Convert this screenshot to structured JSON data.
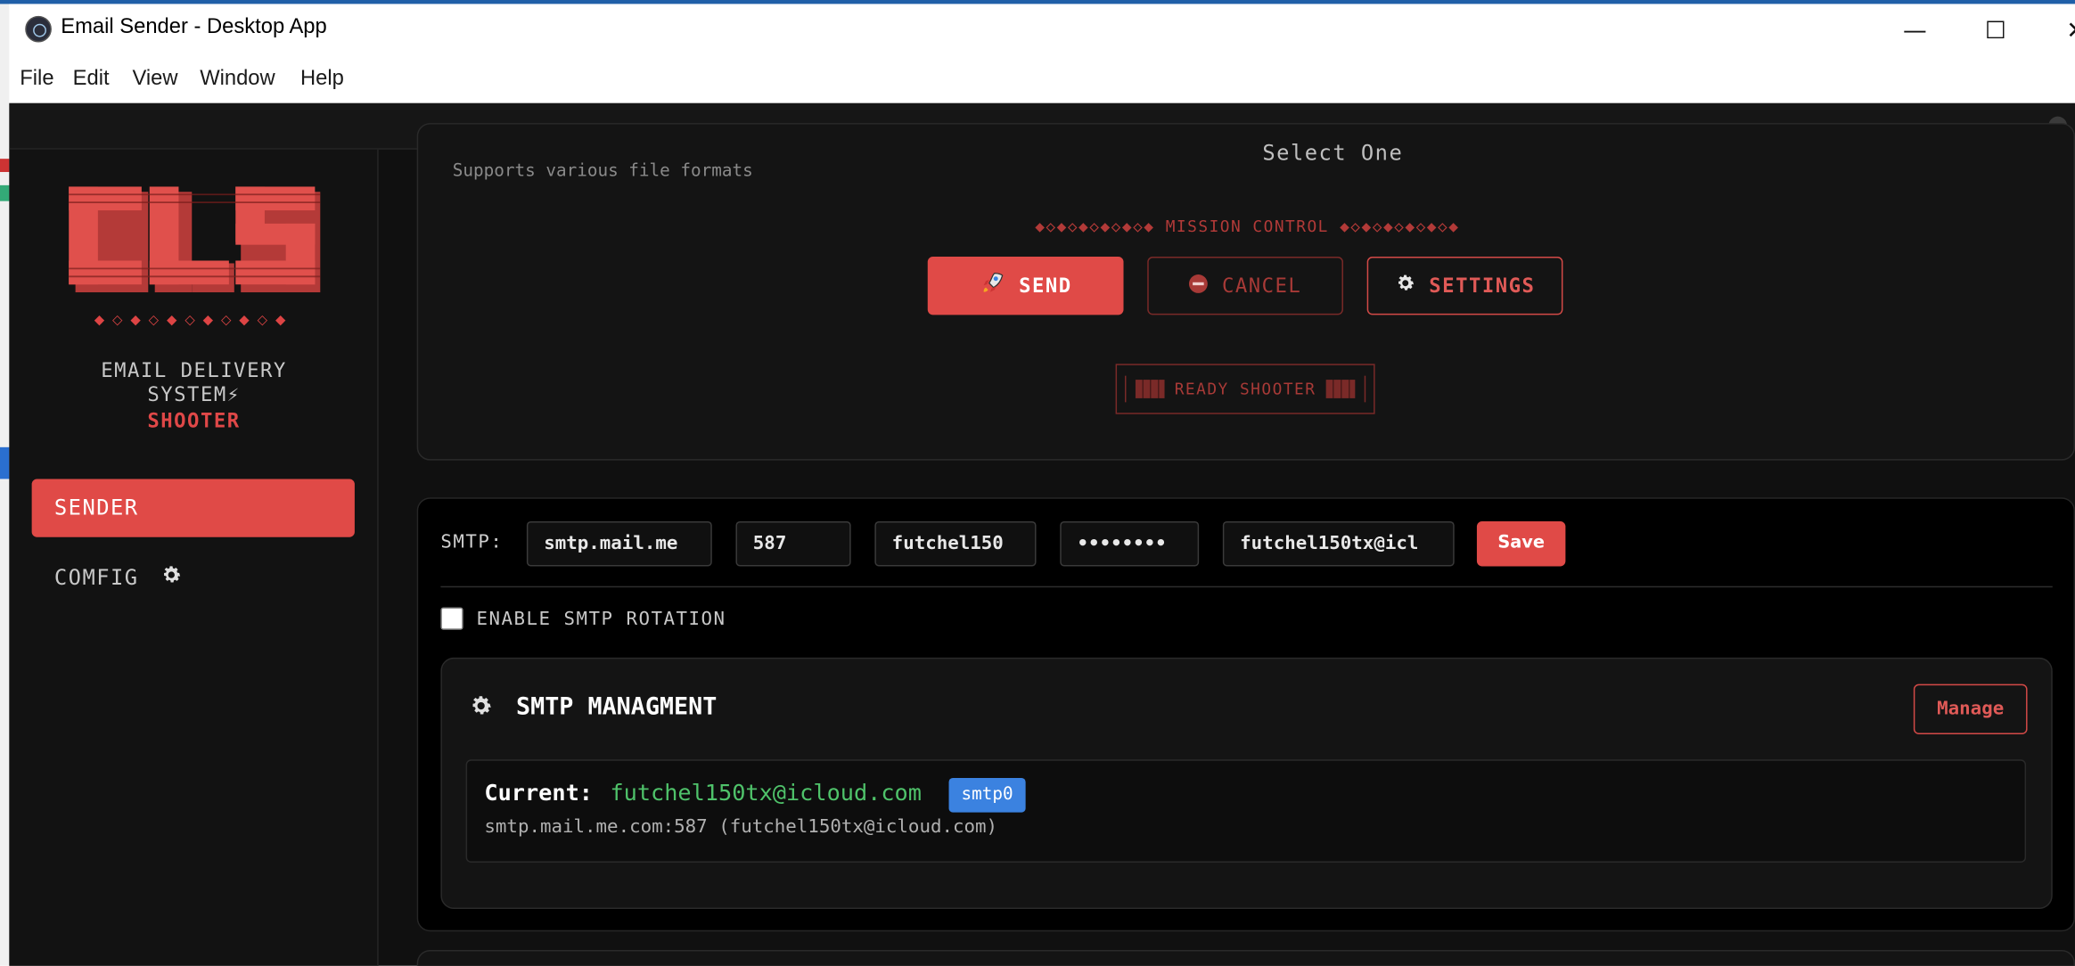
{
  "window": {
    "title": "Email Sender - Desktop App",
    "controls": {
      "minimize": "—",
      "maximize": "☐",
      "close": "✕"
    }
  },
  "menu": [
    "File",
    "Edit",
    "View",
    "Window",
    "Help"
  ],
  "sidebar": {
    "logo_text": "CLS",
    "diamonds": "◆◇◆◇◆◇◆◇◆◇◆",
    "brand_line1": "EMAIL DELIVERY",
    "brand_line2": "SYSTEM⚡",
    "brand_line3": "SHOOTER",
    "items": [
      {
        "label": "SENDER",
        "active": true
      },
      {
        "label": "COMFIG",
        "icon": "gear-icon",
        "active": false
      }
    ]
  },
  "upload": {
    "hint": "Supports various file formats",
    "select": "Select One"
  },
  "mission": {
    "heading": "◆◇◆◇◆◇◆◇◆◇◆ MISSION CONTROL ◆◇◆◇◆◇◆◇◆◇◆",
    "send_label": "SEND",
    "cancel_label": "CANCEL",
    "settings_label": "SETTINGS",
    "status": "READY SHOOTER"
  },
  "smtp": {
    "label": "SMTP:",
    "host": "smtp.mail.me",
    "port": "587",
    "username": "futchel150",
    "password": "••••••••",
    "from": "futchel150tx@icl",
    "save_label": "Save",
    "rotation_label": "ENABLE SMTP ROTATION",
    "rotation_enabled": false
  },
  "management": {
    "title": "SMTP MANAGMENT",
    "manage_label": "Manage",
    "current_label": "Current:",
    "current_email": "futchel150tx@icloud.com",
    "current_badge": "smtp0",
    "current_detail": "smtp.mail.me.com:587 (futchel150tx@icloud.com)"
  },
  "colors": {
    "accent": "#e04a47",
    "background": "#101010",
    "success": "#4fc26a",
    "badge": "#3b82e0"
  }
}
